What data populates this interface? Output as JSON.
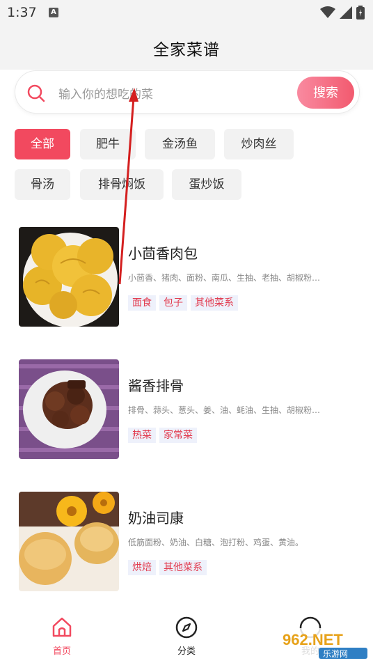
{
  "status": {
    "time": "1:37"
  },
  "header": {
    "title": "全家菜谱"
  },
  "search": {
    "placeholder": "输入你的想吃的菜",
    "button": "搜索"
  },
  "tags": [
    "全部",
    "肥牛",
    "金汤鱼",
    "炒肉丝",
    "骨汤",
    "排骨焖饭",
    "蛋炒饭"
  ],
  "recipes": [
    {
      "name": "小茴香肉包",
      "ingredients": "小茴香、猪肉、面粉、南瓜、生抽、老抽、胡椒粉…",
      "tags": [
        "面食",
        "包子",
        "其他菜系"
      ]
    },
    {
      "name": "酱香排骨",
      "ingredients": "排骨、蒜头、葱头、姜、油、蚝油、生抽、胡椒粉…",
      "tags": [
        "热菜",
        "家常菜"
      ]
    },
    {
      "name": "奶油司康",
      "ingredients": "低筋面粉、奶油、白糖、泡打粉、鸡蛋、黄油。",
      "tags": [
        "烘焙",
        "其他菜系"
      ]
    }
  ],
  "nav": [
    {
      "label": "首页",
      "color": "#f2495f"
    },
    {
      "label": "分类",
      "color": "#222222"
    },
    {
      "label": "我的",
      "color": "#222222"
    }
  ],
  "watermark": {
    "top": "962.NET",
    "bottom": "乐游网"
  },
  "colors": {
    "accent": "#f2495f",
    "tag_bg": "#eef1fb"
  }
}
